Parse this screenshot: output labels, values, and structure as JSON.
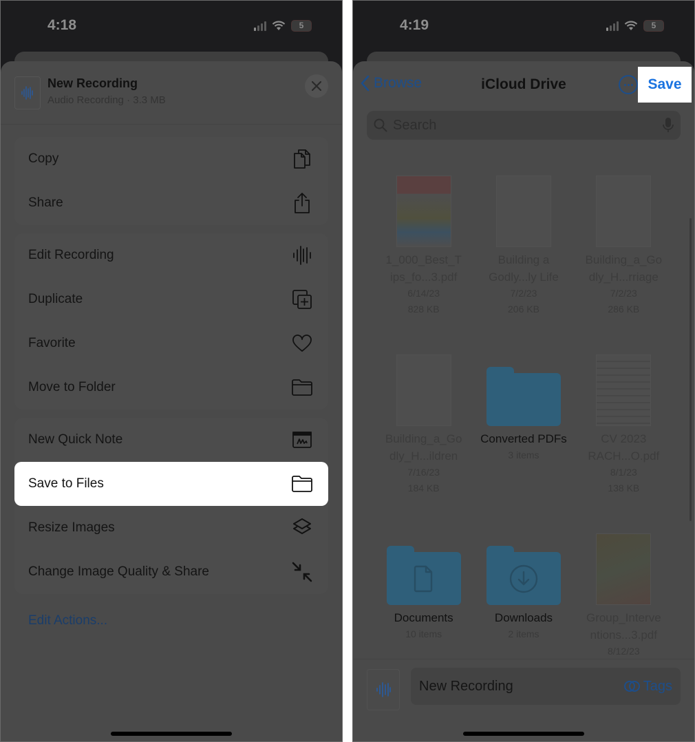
{
  "left": {
    "status": {
      "time": "4:18",
      "battery": "5"
    },
    "header": {
      "title": "New Recording",
      "subtitle": "Audio Recording · 3.3 MB"
    },
    "groups": [
      {
        "items": [
          {
            "label": "Copy",
            "icon": "copy-icon"
          },
          {
            "label": "Share",
            "icon": "share-icon"
          }
        ]
      },
      {
        "items": [
          {
            "label": "Edit Recording",
            "icon": "waveform-icon"
          },
          {
            "label": "Duplicate",
            "icon": "duplicate-icon"
          },
          {
            "label": "Favorite",
            "icon": "heart-icon"
          },
          {
            "label": "Move to Folder",
            "icon": "folder-icon"
          }
        ]
      },
      {
        "items": [
          {
            "label": "New Quick Note",
            "icon": "quick-note-icon"
          },
          {
            "label": "Save to Files",
            "icon": "folder-icon",
            "highlighted": true
          },
          {
            "label": "Resize Images",
            "icon": "layers-icon"
          },
          {
            "label": "Change Image Quality & Share",
            "icon": "compress-arrows-icon"
          }
        ]
      }
    ],
    "edit_actions": "Edit Actions..."
  },
  "right": {
    "status": {
      "time": "4:19",
      "battery": "5"
    },
    "nav": {
      "back_label": "Browse",
      "title": "iCloud Drive",
      "save_label": "Save"
    },
    "search": {
      "placeholder": "Search"
    },
    "items": [
      {
        "name": "1_000_Best_T ips_fo...3.pdf",
        "line1": "6/14/23",
        "line2": "828 KB",
        "kind": "file"
      },
      {
        "name": "Building a Godly...ly Life",
        "line1": "7/2/23",
        "line2": "206 KB",
        "kind": "file"
      },
      {
        "name": "Building_a_Go dly_H...rriage",
        "line1": "7/2/23",
        "line2": "286 KB",
        "kind": "file"
      },
      {
        "name": "Building_a_Go dly_H...ildren",
        "line1": "7/16/23",
        "line2": "184 KB",
        "kind": "file"
      },
      {
        "name": "Converted PDFs",
        "line1": "3 items",
        "line2": "",
        "kind": "folder"
      },
      {
        "name": "CV 2023 RACH...O.pdf",
        "line1": "8/1/23",
        "line2": "138 KB",
        "kind": "file"
      },
      {
        "name": "Documents",
        "line1": "10 items",
        "line2": "",
        "kind": "folder-doc"
      },
      {
        "name": "Downloads",
        "line1": "2 items",
        "line2": "",
        "kind": "folder-download"
      },
      {
        "name": "Group_Interve ntions...3.pdf",
        "line1": "8/12/23",
        "line2": "",
        "kind": "file"
      }
    ],
    "bottom": {
      "filename": "New Recording",
      "tags_label": "Tags"
    }
  },
  "colors": {
    "accent_blue": "#1a73e0",
    "folder": "#2f5f7a",
    "highlight": "#ffffff"
  }
}
